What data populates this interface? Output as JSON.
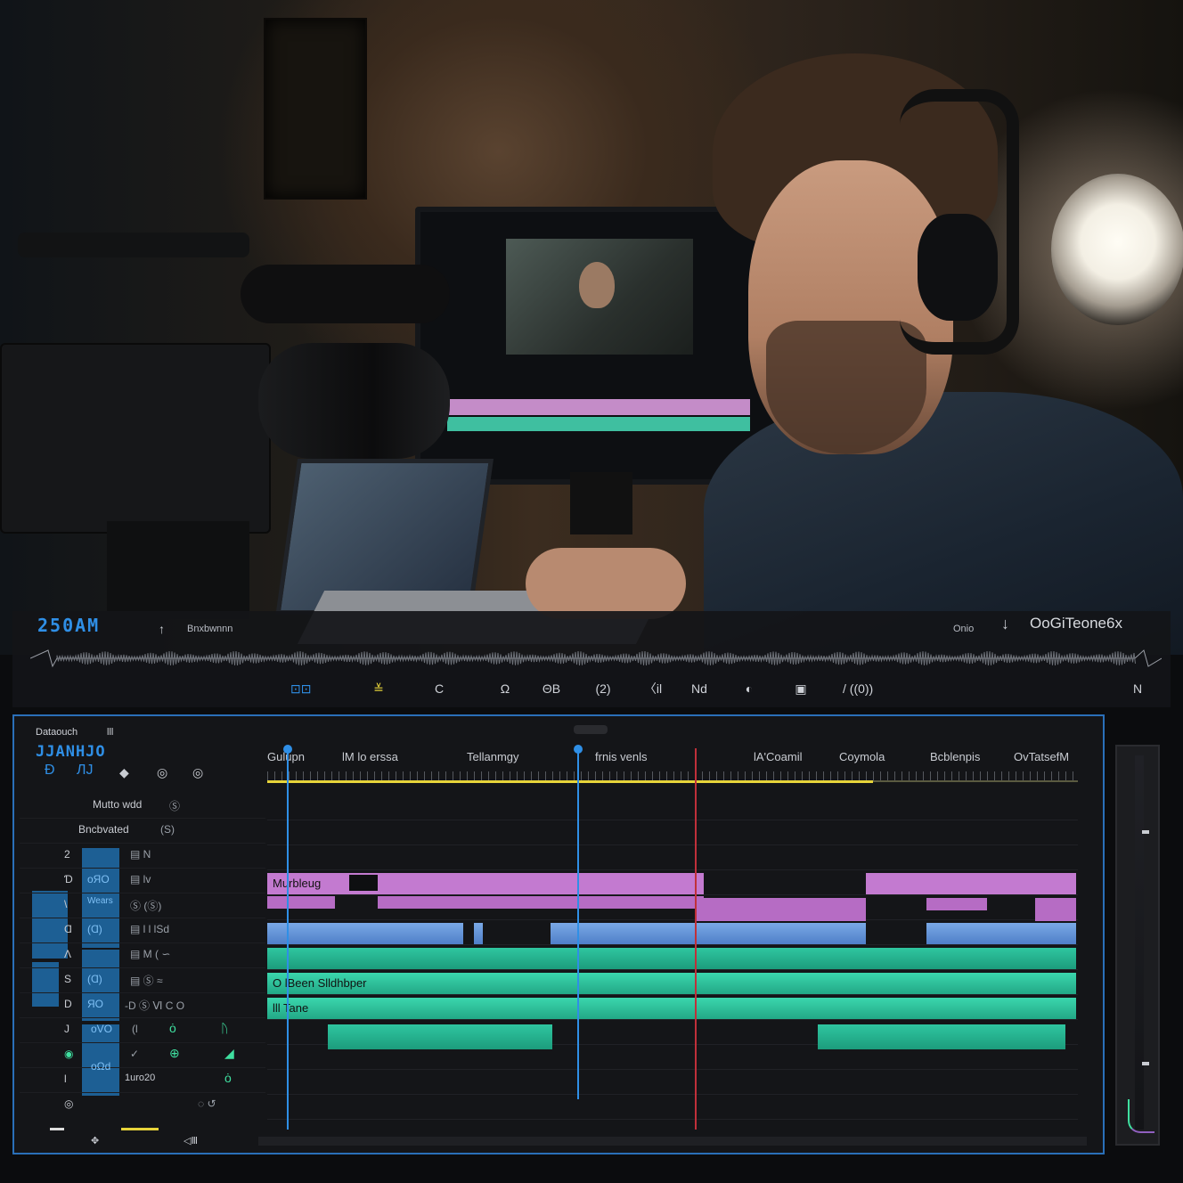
{
  "photo": {
    "scene": ""
  },
  "topbar": {
    "brand": "250AM",
    "brand_sub": "Bnxbwnnn",
    "pin_icon": "pin-icon",
    "audio_label": "Onio",
    "title_right": "OoGiTeone6x",
    "tools": [
      {
        "label": "⊡⊡",
        "icon": "toggle-icon"
      },
      {
        "label": "≚",
        "icon": "marker-icon"
      },
      {
        "label": "C",
        "icon": "loop-icon"
      },
      {
        "label": "Ω",
        "icon": "headphones-icon"
      },
      {
        "label": "ΘB",
        "icon": "link-icon"
      },
      {
        "label": "(2)",
        "icon": "count-icon"
      },
      {
        "label": "〈il",
        "icon": "trim-icon"
      },
      {
        "label": "Nd",
        "icon": "razor-icon"
      },
      {
        "label": "◐",
        "icon": "eye-icon"
      },
      {
        "label": "▣",
        "icon": "frame-icon"
      },
      {
        "label": "/ ((0))",
        "icon": "audio-waves-icon"
      },
      {
        "label": "N",
        "icon": "settings-icon"
      }
    ]
  },
  "editor": {
    "hdr_small": "Dataouch",
    "hdr_small2": "lll",
    "brand": "JJANHJO",
    "header_icons": [
      "Ð",
      "ЛJ",
      "◆",
      "◎",
      "◎"
    ],
    "ruler_labels": [
      "Gulupn",
      "lM lo erssa",
      "Tellanmgy",
      "frnis venls",
      "lA'Coamil",
      "Coymola",
      "Bcblenpis",
      "OvTatsefM"
    ],
    "left_rows": [
      {
        "label": "Mutto wdd",
        "sym": "Ⓢ"
      },
      {
        "label": "Bncbvated",
        "sym": "(S)"
      },
      {
        "label": "2",
        "sym": "▤  N"
      },
      {
        "label": "Ɗ",
        "sym": "▤  lv"
      },
      {
        "label": "\\",
        "sym": "Ⓢ      (Ⓢ)"
      },
      {
        "label": "Ɑ",
        "sym": "▤  l  l  lSd"
      },
      {
        "label": "Λ",
        "sym": "▤  M  (  ∽"
      },
      {
        "label": "S",
        "sym": "▤  Ⓢ  ≈"
      },
      {
        "label": "D",
        "sym": "-D  Ⓢ  Ⅵ  C  O"
      },
      {
        "label": "J",
        "sym": "(l"
      },
      {
        "label": "◉",
        "sym": "✓"
      },
      {
        "label": "l",
        "sym": "1uro20"
      },
      {
        "label": "◎",
        "sym": ""
      }
    ],
    "blue_labels": [
      "oЯO",
      "Wears",
      "(Ɑ)",
      "(Ɑ)",
      "ЯO",
      "oVO",
      "oΩd"
    ],
    "clip_labels": {
      "pink": "Murbleug",
      "teal1": "O  lBeen        Slldhbper",
      "teal2": "lll  Tane"
    }
  },
  "colors": {
    "accent": "#2f8fe6",
    "pink_clip": "#c37ad0",
    "blue_clip": "#6b99dc",
    "teal_clip": "#2fc6a0",
    "playhead_red": "#c0303a",
    "ruler_yellow": "#e7d43a"
  }
}
